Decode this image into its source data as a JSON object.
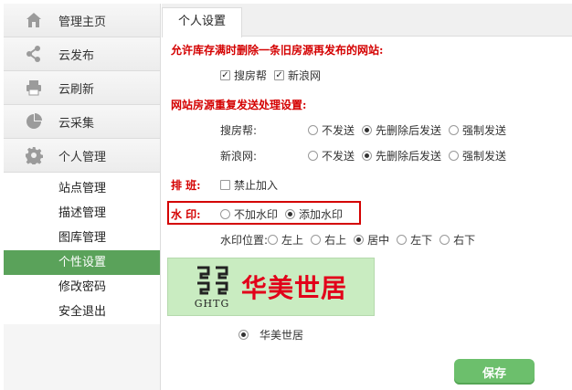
{
  "sidebar": {
    "items": [
      {
        "label": "管理主页",
        "icon": "home-icon"
      },
      {
        "label": "云发布",
        "icon": "share-icon"
      },
      {
        "label": "云刷新",
        "icon": "printer-icon"
      },
      {
        "label": "云采集",
        "icon": "pie-chart-icon"
      },
      {
        "label": "个人管理",
        "icon": "gear-icon"
      }
    ],
    "submenu": [
      "站点管理",
      "描述管理",
      "图库管理",
      "个性设置",
      "修改密码",
      "安全退出"
    ],
    "active_sub": "个性设置"
  },
  "tab": {
    "label": "个人设置"
  },
  "section1": {
    "title": "允许库存满时删除一条旧房源再发布的网站:",
    "options": [
      {
        "label": "搜房帮",
        "checked": true
      },
      {
        "label": "新浪网",
        "checked": true
      }
    ]
  },
  "section2": {
    "title": "网站房源重复发送处理设置:",
    "rows": [
      {
        "site": "搜房帮:",
        "options": [
          "不发送",
          "先删除后发送",
          "强制发送"
        ],
        "selected": "先删除后发送"
      },
      {
        "site": "新浪网:",
        "options": [
          "不发送",
          "先删除后发送",
          "强制发送"
        ],
        "selected": "先删除后发送"
      }
    ]
  },
  "paiban": {
    "label": "排 班:",
    "option": "禁止加入",
    "checked": false
  },
  "watermark": {
    "label": "水 印:",
    "options": [
      "不加水印",
      "添加水印"
    ],
    "selected": "添加水印",
    "position_label": "水印位置:",
    "positions": [
      "左上",
      "右上",
      "居中",
      "左下",
      "右下"
    ],
    "selected_position": "居中"
  },
  "logo": {
    "text_cn": "华美世居",
    "text_en": "GHTG"
  },
  "logo_choice": {
    "label": "华美世居",
    "selected": true
  },
  "save_label": "保存",
  "colors": {
    "accent_red": "#d40000",
    "active_green": "#5aa25a",
    "button_green": "#6cbf6c",
    "logo_bg": "#c9ecc1"
  }
}
